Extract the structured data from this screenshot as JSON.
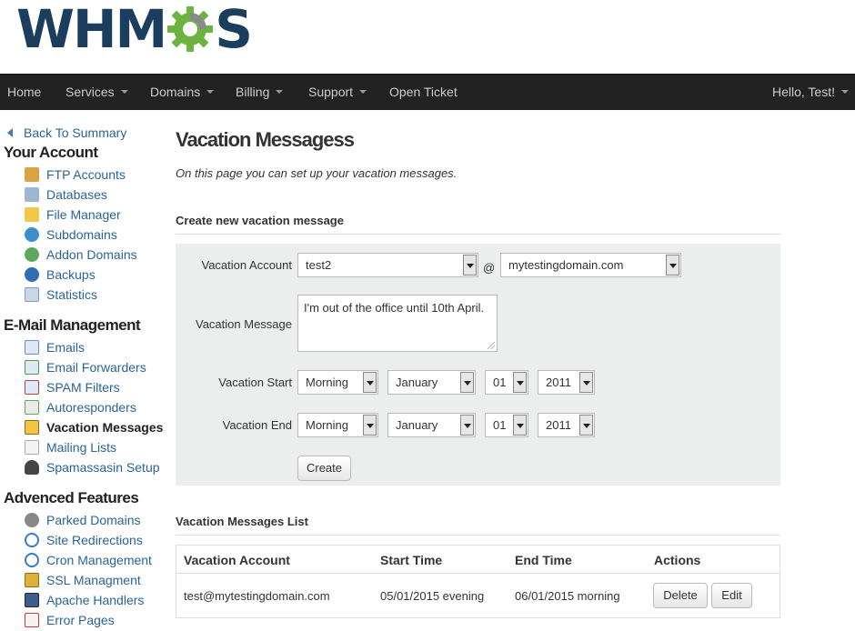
{
  "logo": {
    "text_left": "WHM",
    "text_right": "S"
  },
  "nav": {
    "items": [
      {
        "label": "Home"
      },
      {
        "label": "Services"
      },
      {
        "label": "Domains"
      },
      {
        "label": "Billing"
      },
      {
        "label": "Support"
      },
      {
        "label": "Open Ticket"
      }
    ],
    "user": "Hello, Test!"
  },
  "sidebar": {
    "back": "Back To Summary",
    "sections": [
      {
        "title": "Your Account",
        "items": [
          "FTP Accounts",
          "Databases",
          "File Manager",
          "Subdomains",
          "Addon Domains",
          "Backups",
          "Statistics"
        ]
      },
      {
        "title": "E-Mail Management",
        "items": [
          "Emails",
          "Email Forwarders",
          "SPAM Filters",
          "Autoresponders",
          "Vacation Messages",
          "Mailing Lists",
          "Spamassasin Setup"
        ]
      },
      {
        "title": "Advenced Features",
        "items": [
          "Parked Domains",
          "Site Redirections",
          "Cron Management",
          "SSL Managment",
          "Apache Handlers",
          "Error Pages"
        ]
      }
    ]
  },
  "page": {
    "title": "Vacation Messagess",
    "description": "On this page you can set up your vacation messages."
  },
  "form": {
    "section_title": "Create new vacation message",
    "account_label": "Vacation Account",
    "account_value": "test2",
    "at": "@",
    "domain_value": "mytestingdomain.com",
    "message_label": "Vacation Message",
    "message_value": "I'm out of the office until 10th April.",
    "start_label": "Vacation Start",
    "end_label": "Vacation End",
    "start": {
      "time": "Morning",
      "month": "January",
      "day": "01",
      "year": "2011"
    },
    "end": {
      "time": "Morning",
      "month": "January",
      "day": "01",
      "year": "2011"
    },
    "create_button": "Create"
  },
  "list": {
    "section_title": "Vacation Messages List",
    "headers": [
      "Vacation Account",
      "Start Time",
      "End Time",
      "Actions"
    ],
    "rows": [
      {
        "account": "test@mytestingdomain.com",
        "start": "05/01/2015 evening",
        "end": "06/01/2015 morning",
        "delete": "Delete",
        "edit": "Edit"
      }
    ]
  }
}
